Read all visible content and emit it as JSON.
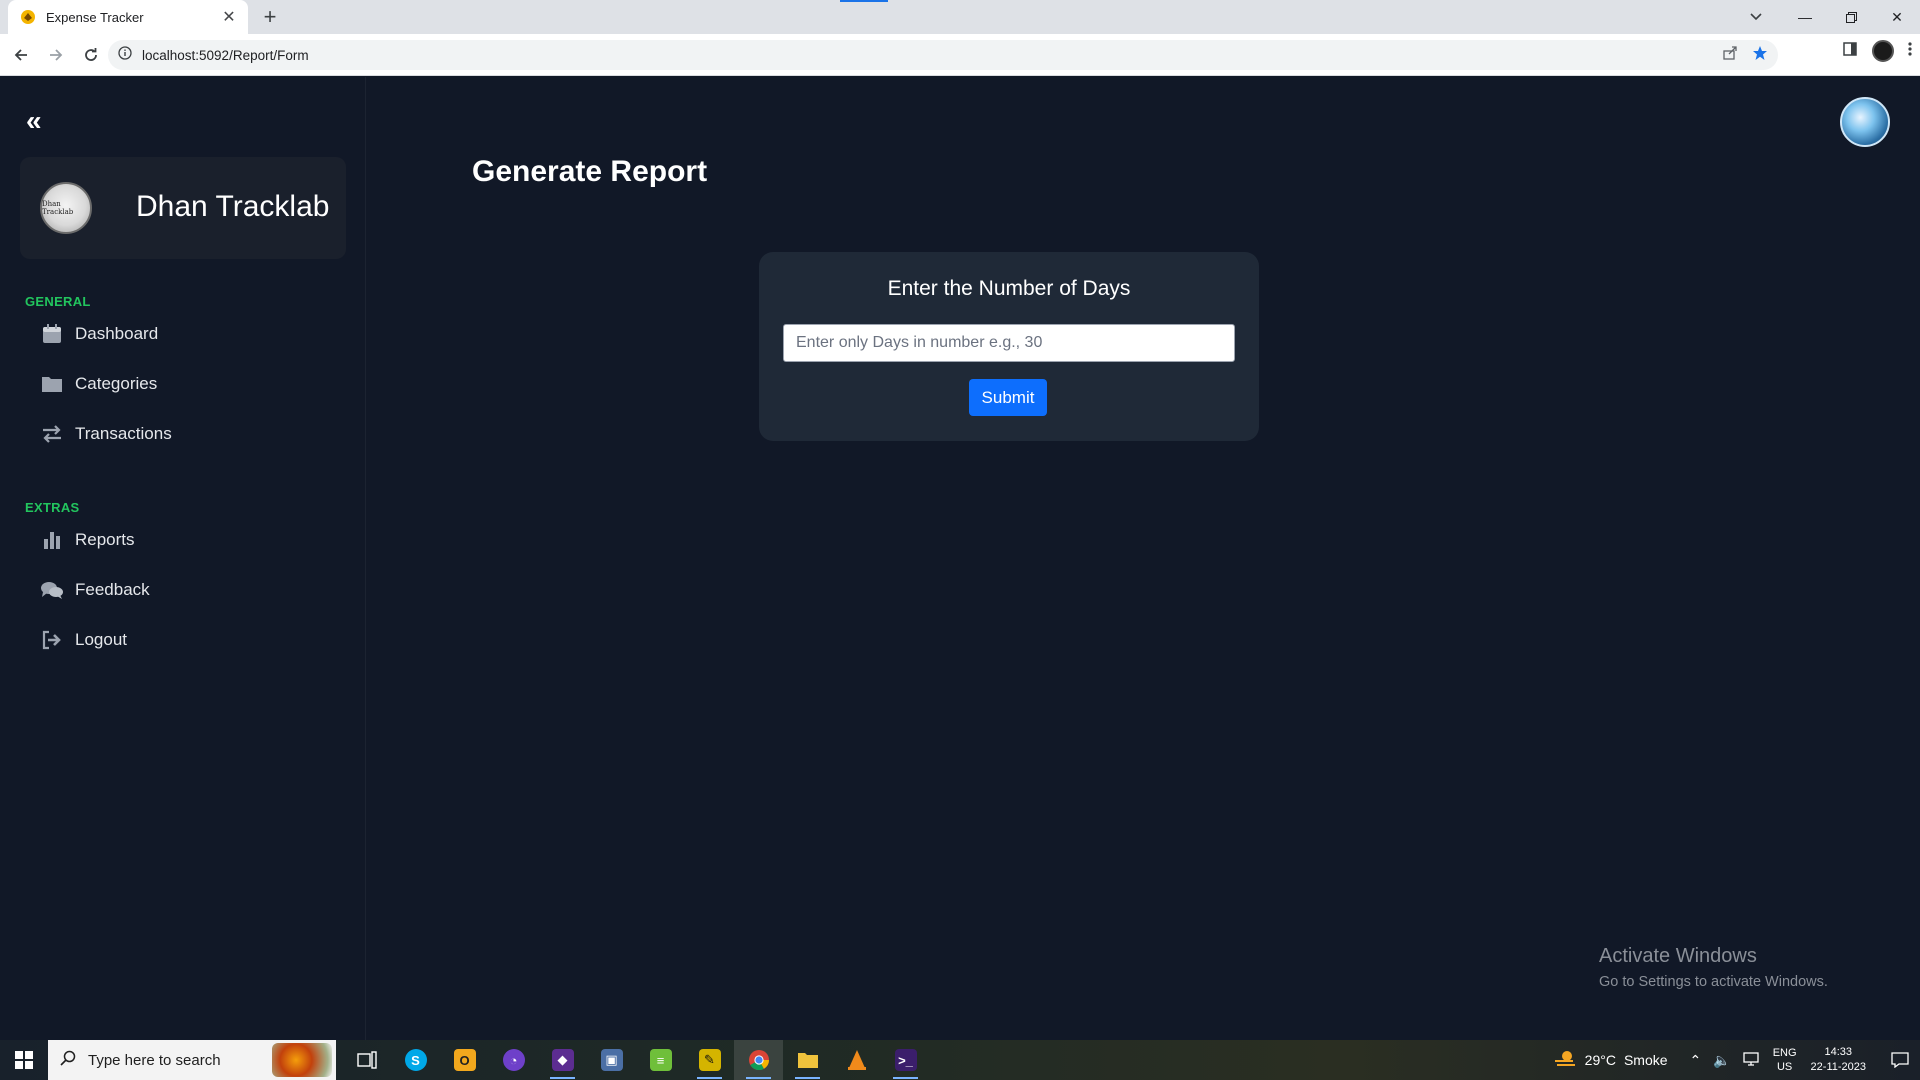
{
  "browser": {
    "tab_title": "Expense Tracker",
    "url": "localhost:5092/Report/Form"
  },
  "sidebar": {
    "brand_name": "Dhan Tracklab",
    "logo_text": "Dhan Tracklab",
    "sections": [
      {
        "label": "GENERAL",
        "items": [
          {
            "label": "Dashboard",
            "icon": "calendar-icon"
          },
          {
            "label": "Categories",
            "icon": "folder-icon"
          },
          {
            "label": "Transactions",
            "icon": "exchange-icon"
          }
        ]
      },
      {
        "label": "EXTRAS",
        "items": [
          {
            "label": "Reports",
            "icon": "bar-chart-icon"
          },
          {
            "label": "Feedback",
            "icon": "comments-icon"
          },
          {
            "label": "Logout",
            "icon": "sign-out-icon"
          }
        ]
      }
    ]
  },
  "main": {
    "page_title": "Generate Report",
    "form": {
      "heading": "Enter the Number of Days",
      "placeholder": "Enter only Days in number e.g., 30",
      "value": "",
      "submit_label": "Submit"
    }
  },
  "watermark": {
    "line1": "Activate Windows",
    "line2": "Go to Settings to activate Windows."
  },
  "taskbar": {
    "search_placeholder": "Type here to search",
    "weather_temp": "29°C",
    "weather_condition": "Smoke",
    "lang_top": "ENG",
    "lang_bottom": "US",
    "time": "14:33",
    "date": "22-11-2023"
  },
  "colors": {
    "app_bg": "#111827",
    "card_bg": "#1f2937",
    "accent_green": "#22c55e",
    "primary_button": "#0d6efd"
  }
}
